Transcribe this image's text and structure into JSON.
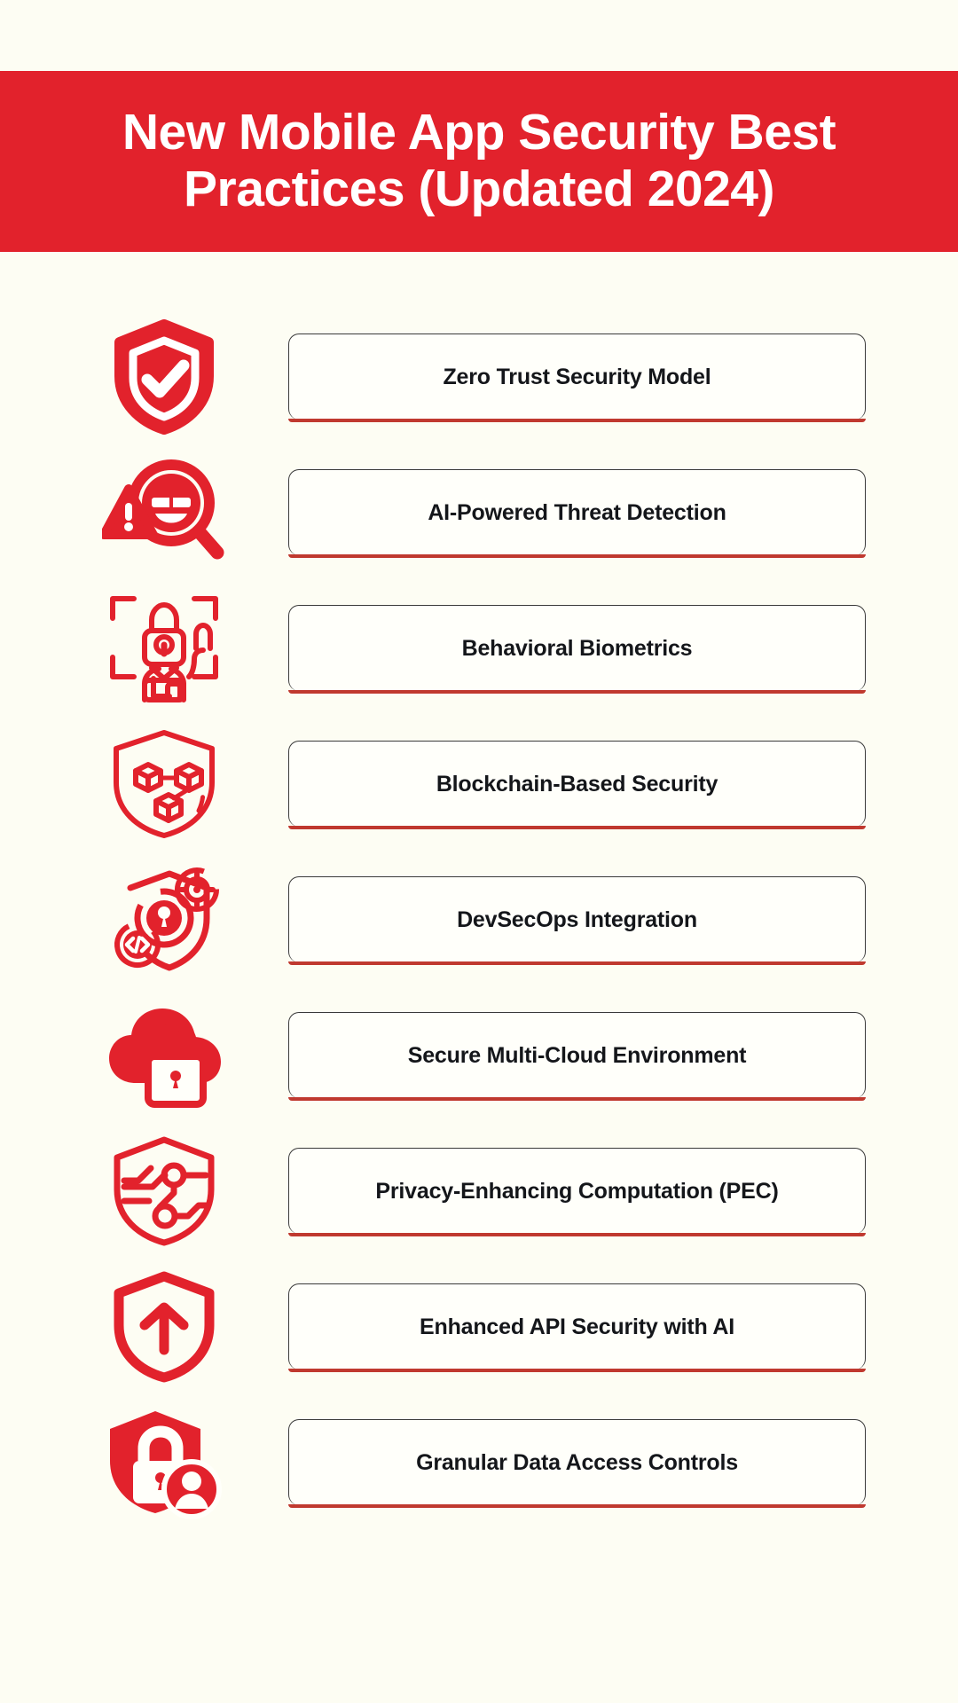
{
  "page": {
    "background_color": "#fdfdf3",
    "accent_color": "#e2222c",
    "card_accent_color": "#c0392f",
    "text_color": "#14161a"
  },
  "header": {
    "title": "New Mobile App Security Best Practices (Updated 2024)",
    "background_color": "#e2222c",
    "text_color": "#ffffff"
  },
  "practices": [
    {
      "label": "Zero Trust Security Model",
      "icon": "shield-check-icon"
    },
    {
      "label": "AI-Powered Threat Detection",
      "icon": "magnifier-hacker-alert-icon"
    },
    {
      "label": "Behavioral Biometrics",
      "icon": "biometric-scan-person-lock-icon"
    },
    {
      "label": "Blockchain-Based Security",
      "icon": "shield-blockchain-cubes-icon"
    },
    {
      "label": "DevSecOps Integration",
      "icon": "shield-gear-code-key-icon"
    },
    {
      "label": "Secure Multi-Cloud Environment",
      "icon": "cloud-padlock-icon"
    },
    {
      "label": "Privacy-Enhancing Computation (PEC)",
      "icon": "shield-circuit-icon"
    },
    {
      "label": "Enhanced API Security with AI",
      "icon": "shield-up-arrow-icon"
    },
    {
      "label": "Granular Data Access Controls",
      "icon": "shield-lock-user-icon"
    }
  ]
}
